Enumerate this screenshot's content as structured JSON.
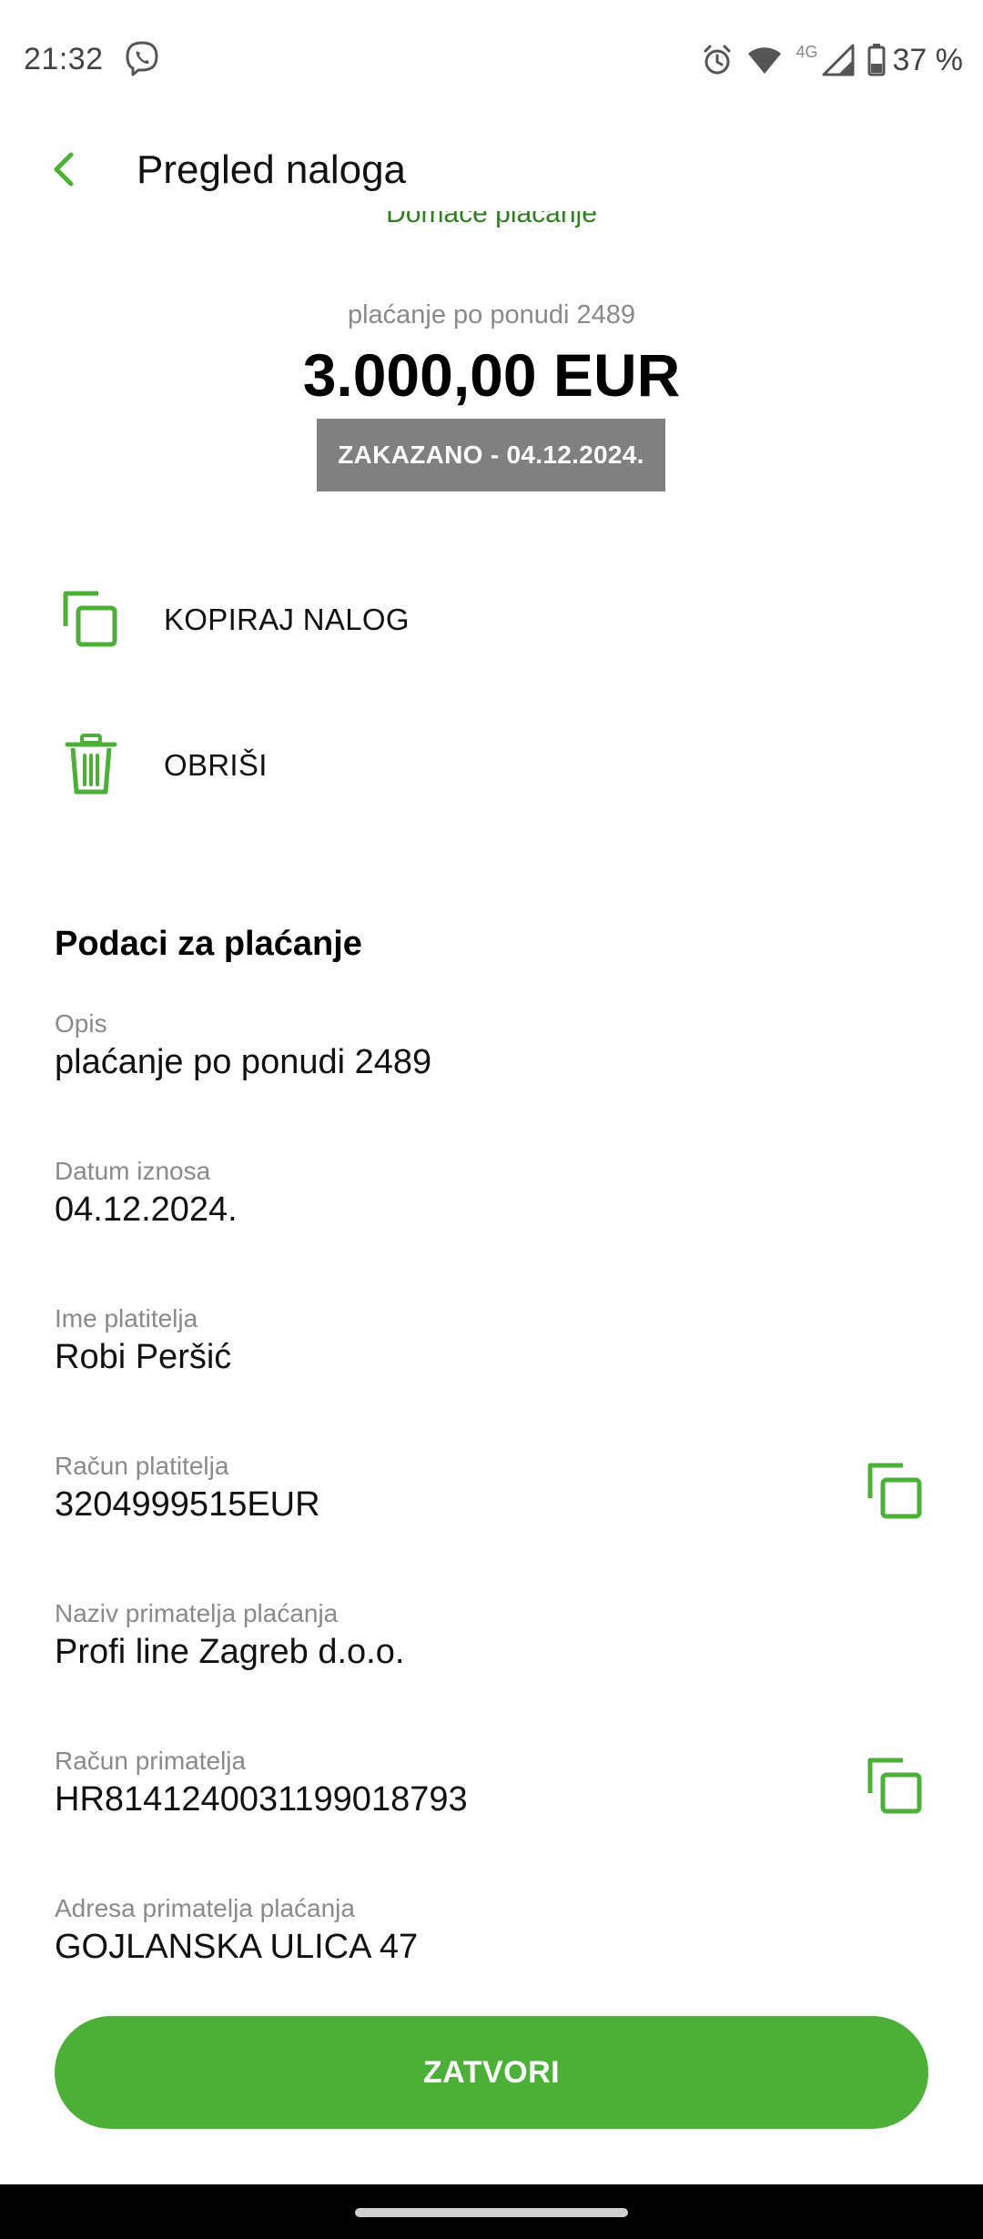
{
  "status_bar": {
    "time": "21:32",
    "network": "4G",
    "battery": "37 %",
    "icons": [
      "viber-icon",
      "alarm-icon",
      "wifi-icon",
      "signal-icon",
      "battery-icon"
    ]
  },
  "app_bar": {
    "title": "Pregled naloga",
    "back_icon": "arrow-left-icon"
  },
  "summary": {
    "payment_type": "Domaće plaćanje",
    "description": "plaćanje po ponudi 2489",
    "amount": "3.000,00 EUR",
    "status": "ZAKAZANO - 04.12.2024."
  },
  "actions": [
    {
      "label": "KOPIRAJ NALOG",
      "icon": "copy-icon"
    },
    {
      "label": "OBRIŠI",
      "icon": "trash-icon"
    }
  ],
  "details": {
    "title": "Podaci za plaćanje",
    "fields": [
      {
        "label": "Opis",
        "value": "plaćanje po ponudi 2489"
      },
      {
        "label": "Datum iznosa",
        "value": "04.12.2024."
      },
      {
        "label": "Ime platitelja",
        "value": "Robi Peršić"
      },
      {
        "label": "Račun platitelja",
        "value": "3204999515EUR"
      },
      {
        "label": "Naziv primatelja plaćanja",
        "value": "Profi line Zagreb d.o.o."
      },
      {
        "label": "Račun primatelja",
        "value": "HR8141240031199018793"
      },
      {
        "label": "Adresa primatelja plaćanja",
        "value": "GOJLANSKA ULICA 47"
      }
    ]
  },
  "footer": {
    "close_label": "ZATVORI"
  },
  "colors": {
    "accent": "#4caf37",
    "badge": "#808080",
    "muted_text": "#8a8a8a"
  }
}
